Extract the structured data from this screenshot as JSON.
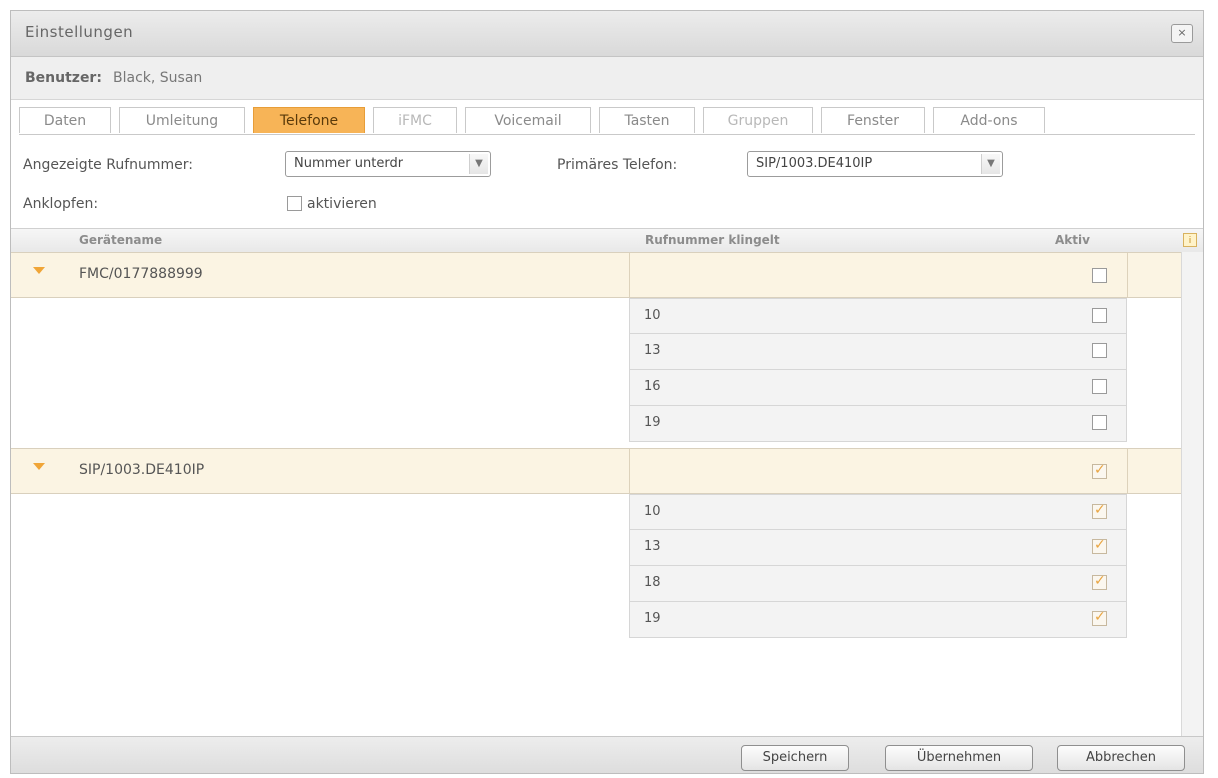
{
  "window": {
    "title": "Einstellungen",
    "close_glyph": "×"
  },
  "user": {
    "label": "Benutzer:",
    "value": "Black, Susan"
  },
  "tabs": [
    {
      "label": "Daten",
      "state": "normal"
    },
    {
      "label": "Umleitung",
      "state": "normal"
    },
    {
      "label": "Telefone",
      "state": "active"
    },
    {
      "label": "iFMC",
      "state": "disabled"
    },
    {
      "label": "Voicemail",
      "state": "normal"
    },
    {
      "label": "Tasten",
      "state": "normal"
    },
    {
      "label": "Gruppen",
      "state": "disabled"
    },
    {
      "label": "Fenster",
      "state": "normal"
    },
    {
      "label": "Add-ons",
      "state": "normal"
    }
  ],
  "form": {
    "displayed_number_label": "Angezeigte Rufnummer:",
    "displayed_number_value": "Nummer unterdr",
    "primary_phone_label": "Primäres Telefon:",
    "primary_phone_value": "SIP/1003.DE410IP",
    "call_waiting_label": "Anklopfen:",
    "call_waiting_checkbox_label": "aktivieren",
    "call_waiting_checked": false
  },
  "table": {
    "columns": {
      "device": "Gerätename",
      "rings": "Rufnummer klingelt",
      "active": "Aktiv"
    },
    "groups": [
      {
        "device": "FMC/0177888999",
        "active": false,
        "rows": [
          {
            "number": "10",
            "active": false
          },
          {
            "number": "13",
            "active": false
          },
          {
            "number": "16",
            "active": false
          },
          {
            "number": "19",
            "active": false
          }
        ]
      },
      {
        "device": "SIP/1003.DE410IP",
        "active": true,
        "rows": [
          {
            "number": "10",
            "active": true
          },
          {
            "number": "13",
            "active": true
          },
          {
            "number": "18",
            "active": true
          },
          {
            "number": "19",
            "active": true
          }
        ]
      }
    ]
  },
  "footer": {
    "save": "Speichern",
    "apply": "Übernehmen",
    "cancel": "Abbrechen"
  },
  "colors": {
    "accent": "#f7b457",
    "group_row": "#fbf4e3",
    "check": "#e9a542"
  }
}
